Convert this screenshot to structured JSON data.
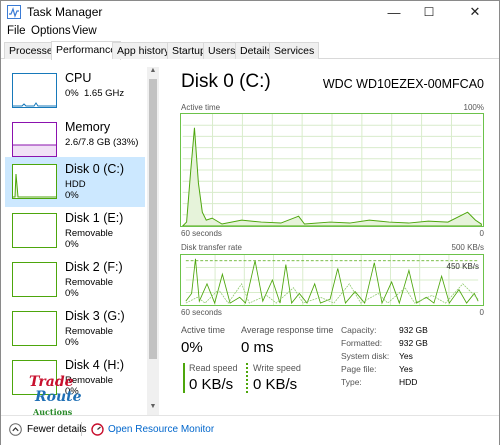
{
  "window": {
    "title": "Task Manager",
    "minimize": "—",
    "maximize": "☐",
    "close": "✕"
  },
  "menu": {
    "file": "File",
    "options": "Options",
    "view": "View"
  },
  "tabs": [
    "Processes",
    "Performance",
    "App history",
    "Startup",
    "Users",
    "Details",
    "Services"
  ],
  "sidebar": [
    {
      "name": "CPU",
      "sub": "0%  1.65 GHz"
    },
    {
      "name": "Memory",
      "sub": "2.6/7.8 GB (33%)"
    },
    {
      "name": "Disk 0 (C:)",
      "sub": "HDD\n0%"
    },
    {
      "name": "Disk 1 (E:)",
      "sub": "Removable\n0%"
    },
    {
      "name": "Disk 2 (F:)",
      "sub": "Removable\n0%"
    },
    {
      "name": "Disk 3 (G:)",
      "sub": "Removable\n0%"
    },
    {
      "name": "Disk 4 (H:)",
      "sub": "Removable\n0%"
    }
  ],
  "main": {
    "title": "Disk 0 (C:)",
    "model": "WDC WD10EZEX-00MFCA0",
    "active_label": "Active time",
    "active_max": "100%",
    "seconds": "60 seconds",
    "zero": "0",
    "transfer_label": "Disk transfer rate",
    "transfer_max": "500 KB/s",
    "transfer_line": "450 KB/s"
  },
  "stats": {
    "active_time_label": "Active time",
    "active_time": "0%",
    "avg_resp_label": "Average response time",
    "avg_resp": "0 ms",
    "read_label": "Read speed",
    "read": "0 KB/s",
    "write_label": "Write speed",
    "write": "0 KB/s"
  },
  "props": [
    {
      "k": "Capacity:",
      "v": "932 GB"
    },
    {
      "k": "Formatted:",
      "v": "932 GB"
    },
    {
      "k": "System disk:",
      "v": "Yes"
    },
    {
      "k": "Page file:",
      "v": "Yes"
    },
    {
      "k": "Type:",
      "v": "HDD"
    }
  ],
  "footer": {
    "fewer": "Fewer details",
    "monitor": "Open Resource Monitor"
  },
  "watermark": {
    "l1": "Trade",
    "l2": "Route",
    "l3": "Auctions"
  },
  "colors": {
    "disk": "#4da60c",
    "memory": "#8b12ae",
    "cpu": "#1779ba",
    "selected": "#cce8ff",
    "link": "#0066cc"
  }
}
